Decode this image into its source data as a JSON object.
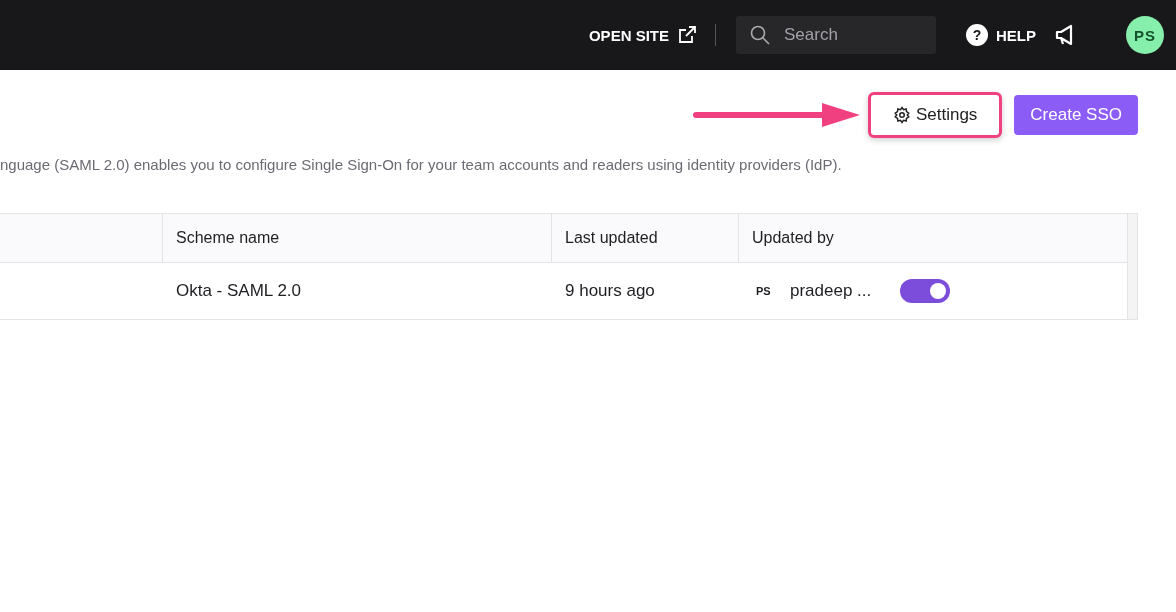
{
  "topbar": {
    "open_site": "OPEN SITE",
    "search": {
      "placeholder": "Search"
    },
    "help_icon": "?",
    "help": "HELP",
    "avatar": "PS"
  },
  "toolbar": {
    "settings": "Settings",
    "settings_highlighted": true,
    "create": "Create SSO"
  },
  "description": "nguage (SAML 2.0) enables you to configure Single Sign-On for your team accounts and readers using identity providers (IdP).",
  "table": {
    "columns": [
      "Scheme name",
      "Last updated",
      "Updated by"
    ],
    "rows": [
      {
        "scheme_name": "Okta - SAML 2.0",
        "last_updated": "9 hours ago",
        "avatar": "PS",
        "updated_by": "pradeep ...",
        "on": true
      }
    ]
  }
}
